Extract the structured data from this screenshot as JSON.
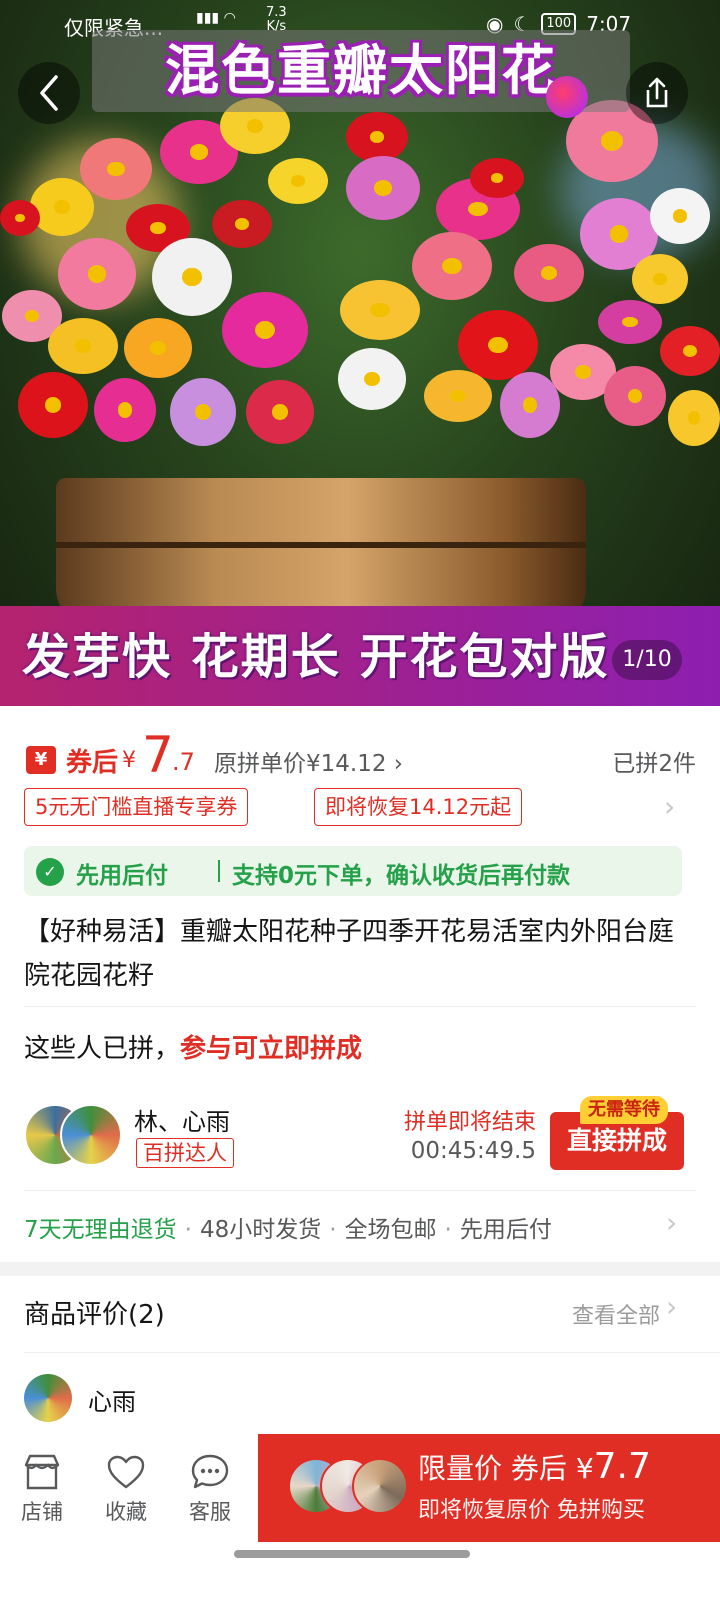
{
  "status_bar": {
    "left_text": "仅限紧急...",
    "net_speed_value": "7.3",
    "net_speed_unit": "K/s",
    "battery": "100",
    "time": "7:07"
  },
  "hero": {
    "title": "混色重瓣太阳花",
    "slogan": "发芽快 花期长 开花包对版",
    "pager": "1/10",
    "back_icon": "chevron-left-icon",
    "share_icon": "share-icon"
  },
  "price": {
    "yen_badge": "¥",
    "coupon_label": "券后",
    "currency": "¥",
    "integer": "7",
    "decimal": ".7",
    "original": "原拼单价¥14.12",
    "sold": "已拼2件"
  },
  "tags": [
    "5元无门槛直播专享券",
    "即将恢复14.12元起"
  ],
  "pay_later": {
    "label": "先用后付",
    "desc": "支持0元下单，确认收货后再付款"
  },
  "product_title": "【好种易活】重瓣太阳花种子四季开花易活室内外阳台庭院花园花籽",
  "group": {
    "heading_plain": "这些人已拼，",
    "heading_red": "参与可立即拼成",
    "names": "林、心雨",
    "badge": "百拼达人",
    "ending_text": "拼单即将结束",
    "countdown": "00:45:49.5",
    "no_wait_badge": "无需等待",
    "join_button": "直接拼成"
  },
  "service": {
    "items": [
      "7天无理由退货",
      "48小时发货",
      "全场包邮",
      "先用后付"
    ]
  },
  "reviews": {
    "title": "商品评价(2)",
    "view_all": "查看全部",
    "first_reviewer": "心雨"
  },
  "bottom_bar": {
    "store": "店铺",
    "favorite": "收藏",
    "service": "客服",
    "buy_line1_prefix": "限量价 券后",
    "buy_currency": "¥",
    "buy_price": "7.7",
    "buy_line2": "即将恢复原价 免拼购买"
  },
  "colors": {
    "accent_red": "#e02e24",
    "green": "#25a14a",
    "slogan_purple": "#8d1fb0"
  }
}
